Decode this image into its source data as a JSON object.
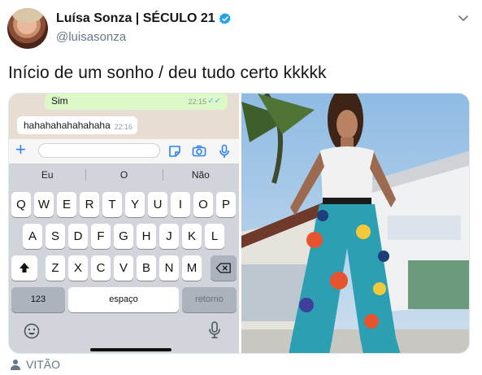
{
  "tweet": {
    "author_name": "Luísa Sonza | SÉCULO 21",
    "handle": "@luisasonza",
    "text": "Início de um sonho / deu tudo certo kkkkk",
    "tagged_user": "VITÃO"
  },
  "chat": {
    "outgoing_message": "Sim",
    "outgoing_time": "22:15",
    "outgoing_ticks": "✓✓",
    "incoming_message": "hahahahahahahaha",
    "incoming_time": "22:16"
  },
  "keyboard": {
    "predictions": [
      "Eu",
      "O",
      "Não"
    ],
    "row1": [
      "Q",
      "W",
      "E",
      "R",
      "T",
      "Y",
      "U",
      "I",
      "O",
      "P"
    ],
    "row2": [
      "A",
      "S",
      "D",
      "F",
      "G",
      "H",
      "J",
      "K",
      "L"
    ],
    "row3": [
      "Z",
      "X",
      "C",
      "V",
      "B",
      "N",
      "M"
    ],
    "numbers_key": "123",
    "space_key": "espaço",
    "return_key": "retorno",
    "plus_symbol": "+"
  },
  "colors": {
    "verified": "#1da1f2",
    "handle": "#657786",
    "ios_blue": "#2f80ed",
    "chat_bubble_out": "#dcf8c6"
  },
  "icons": {
    "verified": "verified-badge-icon",
    "menu": "chevron-down-icon",
    "attach": "plus-icon",
    "sticker": "sticker-icon",
    "camera": "camera-icon",
    "mic": "microphone-icon",
    "shift": "shift-icon",
    "backspace": "backspace-icon",
    "emoji": "emoji-icon",
    "tag": "person-icon"
  }
}
